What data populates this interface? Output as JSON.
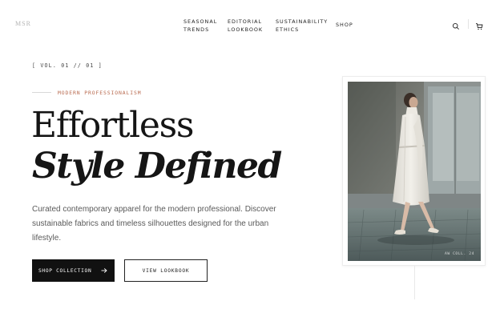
{
  "brand": {
    "logo_text": "MSR"
  },
  "nav": {
    "items": [
      {
        "line1": "SEASONAL",
        "line2": "TRENDS"
      },
      {
        "line1": "EDITORIAL",
        "line2": "LOOKBOOK"
      },
      {
        "line1": "SUSTAINABILITY",
        "line2": "ETHICS"
      },
      {
        "line1": "SHOP",
        "line2": ""
      }
    ],
    "icons": [
      "search-icon",
      "cart-icon"
    ]
  },
  "hero": {
    "issue": "[ VOL. 01 // 01 ]",
    "eyebrow": "MODERN PROFESSIONALISM",
    "headline_line1": "Effortless",
    "headline_line2": "Style Defined",
    "description": "Curated contemporary apparel for the modern professional. Discover sustainable fabrics and timeless silhouettes designed for the urban lifestyle.",
    "primary_button": "SHOP COLLECTION",
    "secondary_button": "VIEW LOOKBOOK"
  },
  "photo": {
    "caption": "AW COLL. 24"
  },
  "colors": {
    "accent": "#b86a4f",
    "button_dark": "#111111",
    "text": "#151515",
    "muted_text": "#5a5a5a"
  }
}
